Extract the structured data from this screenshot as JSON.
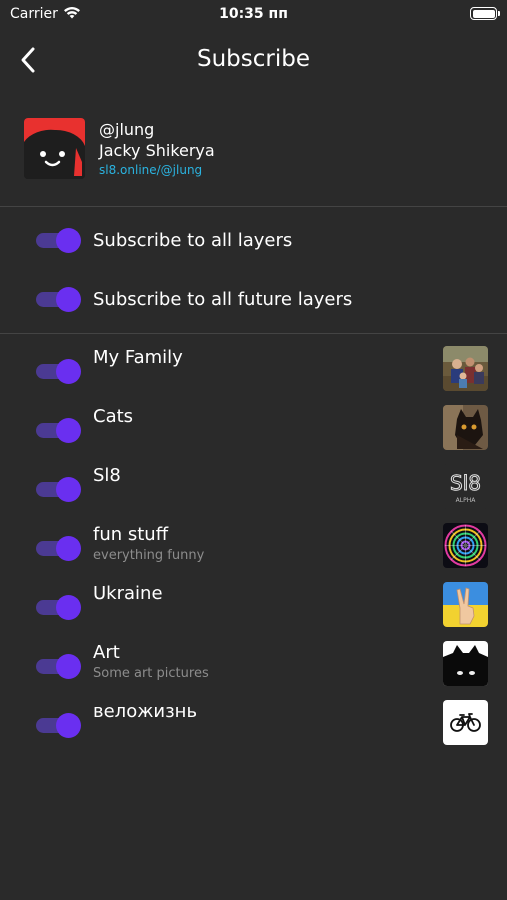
{
  "status_bar": {
    "carrier": "Carrier",
    "time": "10:35 пп",
    "icons": [
      "wifi-icon",
      "battery-icon"
    ]
  },
  "nav": {
    "title": "Subscribe",
    "back_icon": "chevron-left-icon"
  },
  "profile": {
    "handle": "@jlung",
    "name": "Jacky Shikerya",
    "link": "sl8.online/@jlung"
  },
  "global_toggles": [
    {
      "label": "Subscribe to all layers",
      "on": true
    },
    {
      "label": "Subscribe to all future layers",
      "on": true
    }
  ],
  "layers": [
    {
      "title": "My Family",
      "subtitle": "",
      "on": true,
      "thumb": "family-photo"
    },
    {
      "title": "Cats",
      "subtitle": "",
      "on": true,
      "thumb": "cat-photo"
    },
    {
      "title": "Sl8",
      "subtitle": "",
      "on": true,
      "thumb": "sl8-logo",
      "thumb_text": "Sl8",
      "thumb_caption": "ALPHA"
    },
    {
      "title": "fun stuff",
      "subtitle": "everything funny",
      "on": true,
      "thumb": "spiral-art"
    },
    {
      "title": "Ukraine",
      "subtitle": "",
      "on": true,
      "thumb": "ukraine-flag-peace-hand"
    },
    {
      "title": "Art",
      "subtitle": "Some art pictures",
      "on": true,
      "thumb": "black-cat-art"
    },
    {
      "title": "веложизнь",
      "subtitle": "",
      "on": true,
      "thumb": "bicycle-icon"
    }
  ],
  "colors": {
    "background": "#2a2a2a",
    "toggle_track": "#4b3a93",
    "toggle_knob": "#6a2ff0",
    "link": "#2bb3e0",
    "subtitle": "#8c8c8c",
    "divider": "#444444"
  }
}
